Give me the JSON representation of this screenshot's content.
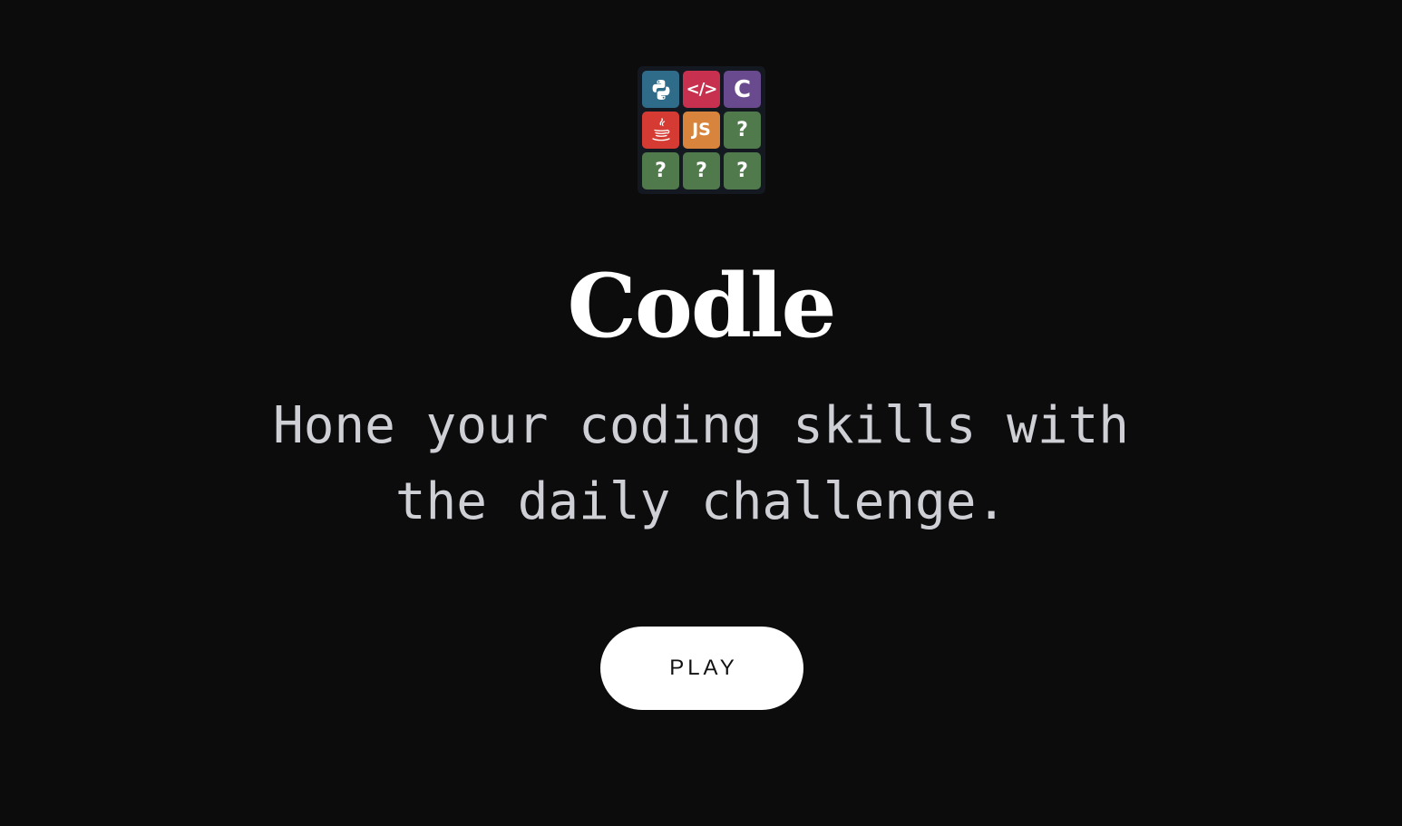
{
  "colors": {
    "background": "#0c0c0d",
    "title": "#ffffff",
    "tagline": "#cfd0d6",
    "button_bg": "#ffffff",
    "button_text": "#111111",
    "tile_python": "#2f6c8a",
    "tile_html": "#c7304f",
    "tile_c": "#6a4a8f",
    "tile_java": "#d63b33",
    "tile_js": "#d8843c",
    "tile_unknown": "#507a4c"
  },
  "logo": {
    "tiles": [
      {
        "icon": "python-icon",
        "text": ""
      },
      {
        "icon": "code-brackets-icon",
        "text": "</>"
      },
      {
        "icon": "c-language-icon",
        "text": "C"
      },
      {
        "icon": "java-icon",
        "text": ""
      },
      {
        "icon": "javascript-icon",
        "text": "JS"
      },
      {
        "icon": "question-mark-icon",
        "text": "?"
      },
      {
        "icon": "question-mark-icon",
        "text": "?"
      },
      {
        "icon": "question-mark-icon",
        "text": "?"
      },
      {
        "icon": "question-mark-icon",
        "text": "?"
      }
    ]
  },
  "title": "Codle",
  "tagline": "Hone your coding skills with the daily challenge.",
  "play_button": {
    "label": "PLAY"
  }
}
